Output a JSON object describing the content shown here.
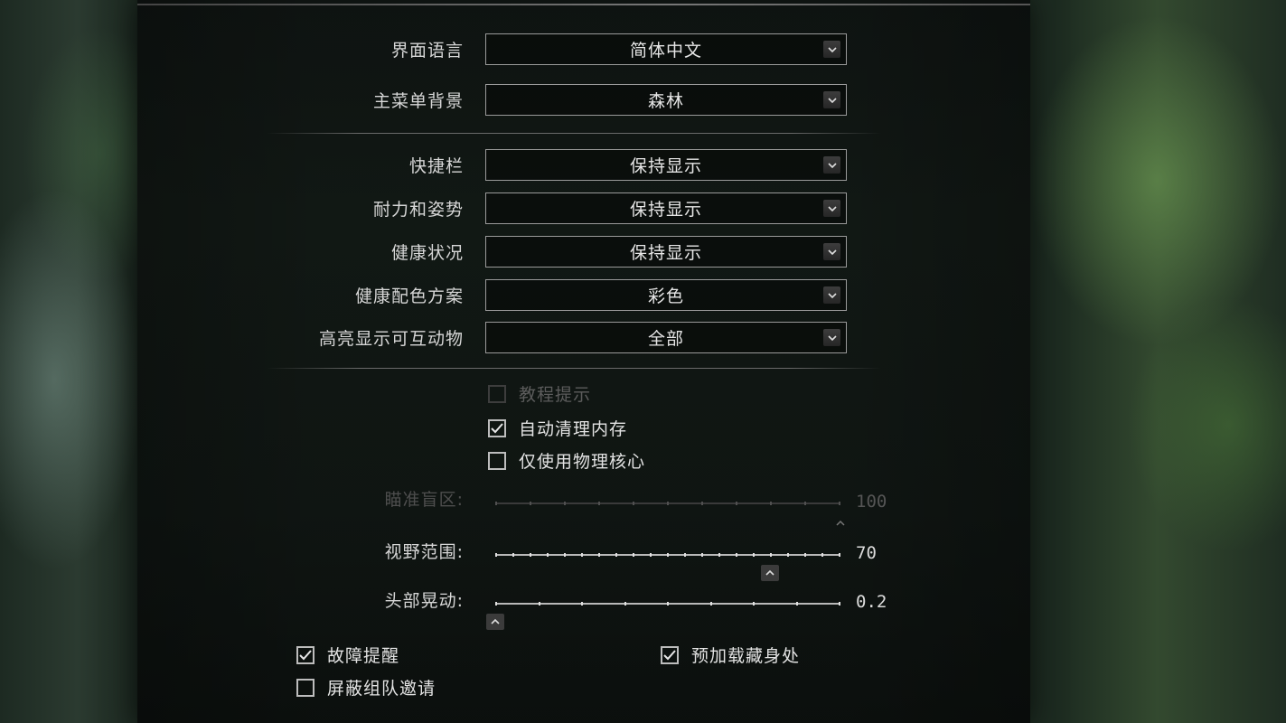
{
  "interface": {
    "rows": [
      {
        "label": "界面语言",
        "value": "简体中文"
      },
      {
        "label": "主菜单背景",
        "value": "森林"
      }
    ]
  },
  "hud": {
    "rows": [
      {
        "label": "快捷栏",
        "value": "保持显示"
      },
      {
        "label": "耐力和姿势",
        "value": "保持显示"
      },
      {
        "label": "健康状况",
        "value": "保持显示"
      },
      {
        "label": "健康配色方案",
        "value": "彩色"
      },
      {
        "label": "高亮显示可互动物",
        "value": "全部"
      }
    ]
  },
  "options": {
    "tutorial_hints": {
      "label": "教程提示",
      "checked": false,
      "disabled": true
    },
    "auto_clear_memory": {
      "label": "自动清理内存",
      "checked": true
    },
    "physical_cores_only": {
      "label": "仅使用物理核心",
      "checked": false
    }
  },
  "sliders": {
    "aim_deadzone": {
      "label": "瞄准盲区:",
      "value": "100",
      "level": 1.0,
      "disabled": true
    },
    "fov": {
      "label": "视野范围:",
      "value": "70",
      "level": 0.797
    },
    "head_bob": {
      "label": "头部晃动:",
      "value": "0.2",
      "level": 0.0
    }
  },
  "bottom": {
    "malfunction_alert": {
      "label": "故障提醒",
      "checked": true
    },
    "preload_hideout": {
      "label": "预加载藏身处",
      "checked": true
    },
    "block_group_invites": {
      "label": "屏蔽组队邀请",
      "checked": false
    }
  },
  "icons": {
    "dropdown_arrow": "chevron-down-icon",
    "check": "checkmark-icon",
    "slider_handle": "chevron-up-icon"
  }
}
